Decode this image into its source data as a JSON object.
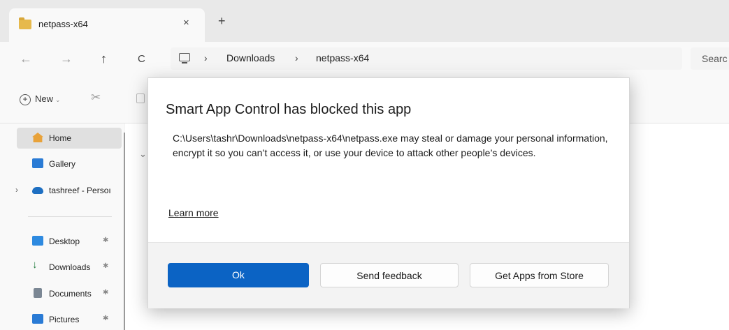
{
  "tab": {
    "title": "netpass-x64",
    "close_glyph": "×",
    "new_glyph": "+"
  },
  "nav": {
    "back": "←",
    "forward": "→",
    "up": "↑",
    "refresh": "C"
  },
  "address": {
    "sep": "›",
    "crumbs": [
      "Downloads",
      "netpass-x64"
    ]
  },
  "search": {
    "placeholder": "Searc"
  },
  "toolbar": {
    "new_label": "New",
    "plus": "+",
    "caret": "⌄",
    "cut_glyph": "✂"
  },
  "sidebar": {
    "items": [
      {
        "label": "Home"
      },
      {
        "label": "Gallery"
      },
      {
        "label": "tashreef - Persoı",
        "expand": "›"
      },
      {
        "label": "Desktop"
      },
      {
        "label": "Downloads"
      },
      {
        "label": "Documents"
      },
      {
        "label": "Pictures"
      }
    ],
    "pin_glyph": "✱"
  },
  "main": {
    "chevron": "⌄"
  },
  "dialog": {
    "title": "Smart App Control has blocked this app",
    "message": "C:\\Users\\tashr\\Downloads\\netpass-x64\\netpass.exe may steal or damage your personal information, encrypt it so you can’t access it, or use your device to attack other people’s devices.",
    "link": "Learn more",
    "buttons": {
      "ok": "Ok",
      "feedback": "Send feedback",
      "store": "Get Apps from Store"
    }
  },
  "colors": {
    "primary_button": "#0b63c4",
    "folder": "#e6b94c"
  },
  "icons": [
    "folder-icon",
    "computer-icon",
    "home-icon",
    "gallery-icon",
    "cloud-icon",
    "desktop-icon",
    "download-icon",
    "documents-icon",
    "pictures-icon",
    "pin-icon",
    "cut-icon",
    "copy-icon"
  ]
}
